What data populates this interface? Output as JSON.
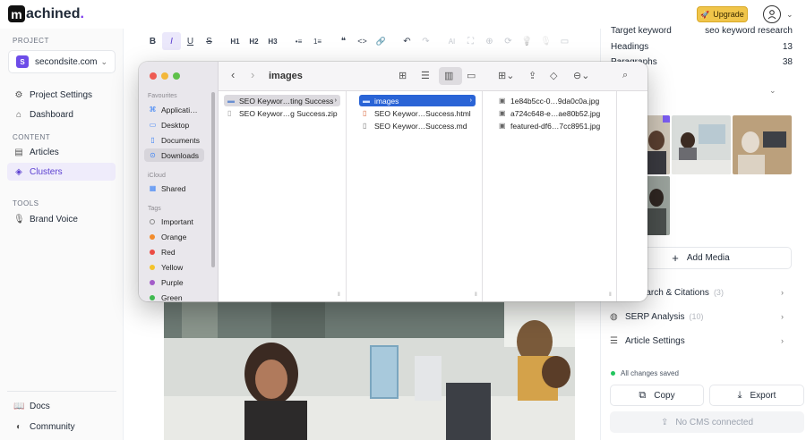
{
  "app": {
    "logo_letter": "m",
    "logo_rest": "achined",
    "logo_dot": "."
  },
  "header": {
    "upgrade_label": "Upgrade"
  },
  "sidebar": {
    "project_section": "PROJECT",
    "project": {
      "badge": "S",
      "name": "secondsite.com"
    },
    "items_main": [
      {
        "label": "Project Settings",
        "icon": "gear-icon"
      },
      {
        "label": "Dashboard",
        "icon": "home-icon"
      }
    ],
    "content_section": "CONTENT",
    "items_content": [
      {
        "label": "Articles",
        "icon": "document-icon"
      },
      {
        "label": "Clusters",
        "icon": "layers-icon",
        "active": true
      }
    ],
    "tools_section": "TOOLS",
    "items_tools": [
      {
        "label": "Brand Voice",
        "icon": "microphone-icon"
      }
    ],
    "items_bottom": [
      {
        "label": "Docs",
        "icon": "book-icon"
      },
      {
        "label": "Community",
        "icon": "discord-icon"
      }
    ]
  },
  "toolbar": {
    "buttons": [
      "B",
      "I",
      "U",
      "S",
      "H1",
      "H2",
      "H3",
      "•≡",
      "1≡",
      "❝",
      "<>",
      "🔗",
      "↶",
      "↷",
      "AI",
      "⛶",
      "⊕",
      "⟳",
      "💡",
      "🎙",
      "▭"
    ]
  },
  "rpanel": {
    "stats": [
      {
        "label": "Target keyword",
        "value": "seo keyword research"
      },
      {
        "label": "Headings",
        "value": "13"
      },
      {
        "label": "Paragraphs",
        "value": "38"
      }
    ],
    "add_media": "Add Media",
    "accordions": [
      {
        "label": "Research & Citations",
        "count": "(3)",
        "icon": "search-icon"
      },
      {
        "label": "SERP Analysis",
        "count": "(10)",
        "icon": "globe-icon"
      },
      {
        "label": "Article Settings",
        "count": "",
        "icon": "sliders-icon"
      }
    ],
    "saved": "All changes saved",
    "copy": "Copy",
    "export": "Export",
    "cms": "No CMS connected"
  },
  "finder": {
    "title": "images",
    "favourites_label": "Favourites",
    "favourites": [
      {
        "label": "Applicati…",
        "icon": "applications-icon"
      },
      {
        "label": "Desktop",
        "icon": "desktop-icon"
      },
      {
        "label": "Documents",
        "icon": "documents-icon"
      },
      {
        "label": "Downloads",
        "icon": "downloads-icon",
        "active": true
      }
    ],
    "icloud_label": "iCloud",
    "icloud": [
      {
        "label": "Shared",
        "icon": "shared-folder-icon"
      }
    ],
    "tags_label": "Tags",
    "tags": [
      {
        "label": "Important",
        "color": ""
      },
      {
        "label": "Orange",
        "color": "#f28b2b"
      },
      {
        "label": "Red",
        "color": "#ec4b43"
      },
      {
        "label": "Yellow",
        "color": "#f4c32b"
      },
      {
        "label": "Purple",
        "color": "#a35cc9"
      },
      {
        "label": "Green",
        "color": "#3fb950"
      }
    ],
    "col1": [
      {
        "label": "SEO Keywor…ting Success",
        "kind": "folder",
        "selected": "gray"
      },
      {
        "label": "SEO Keywor…g Success.zip",
        "kind": "zip",
        "selected": ""
      }
    ],
    "col2": [
      {
        "label": "images",
        "kind": "folder",
        "selected": "blue"
      },
      {
        "label": "SEO Keywor…Success.html",
        "kind": "html",
        "selected": ""
      },
      {
        "label": "SEO Keywor…Success.md",
        "kind": "md",
        "selected": ""
      }
    ],
    "col3": [
      {
        "label": "1e84b5cc-0…9da0c0a.jpg",
        "kind": "jpg"
      },
      {
        "label": "a724c648-e…ae80b52.jpg",
        "kind": "jpg"
      },
      {
        "label": "featured-df6…7cc8951.jpg",
        "kind": "jpg"
      }
    ]
  }
}
